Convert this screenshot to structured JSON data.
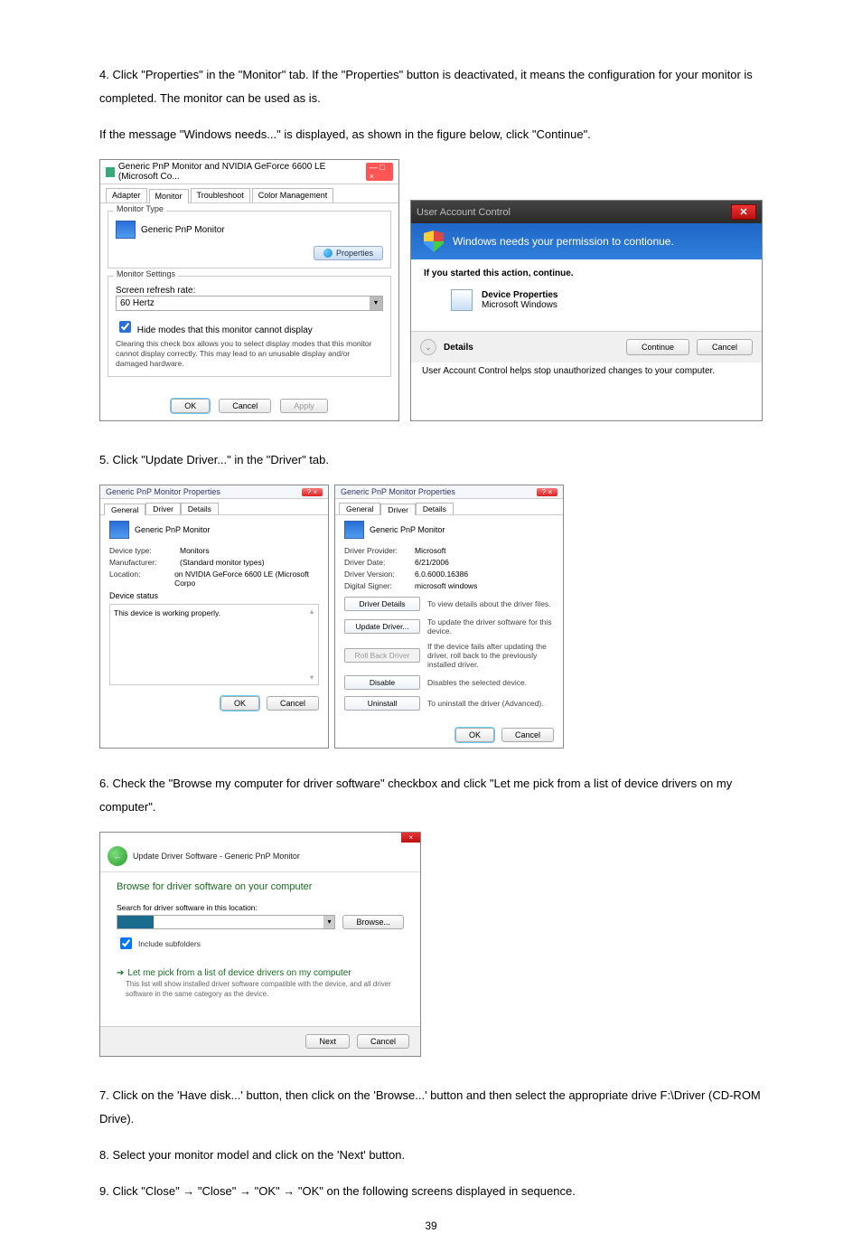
{
  "text": {
    "step4": "4. Click \"Properties\" in the \"Monitor\" tab. If the \"Properties\" button is deactivated, it means the configuration for your monitor is completed. The monitor can be used as is.",
    "step4b": "If the message \"Windows needs...\" is displayed, as shown in the figure below, click \"Continue\".",
    "step5": "5. Click \"Update Driver...\" in the \"Driver\" tab.",
    "step6": "6. Check the \"Browse my computer for driver software\" checkbox and click \"Let me pick from a list of device drivers on my computer\".",
    "step7": "7. Click on the 'Have disk...' button, then click on the 'Browse...' button and then select the appropriate drive F:\\Driver (CD-ROM Drive).",
    "step8": "8. Select your monitor model and click on the 'Next' button.",
    "step9": "9. Click \"Close\"  →  \"Close\"  →  \"OK\"  →  \"OK\" on the following screens displayed in sequence."
  },
  "fig1": {
    "dlg": {
      "title": "Generic PnP Monitor and NVIDIA GeForce 6600 LE (Microsoft Co...",
      "tabs": [
        "Adapter",
        "Monitor",
        "Troubleshoot",
        "Color Management"
      ],
      "group_type": "Monitor Type",
      "monitor_name": "Generic PnP Monitor",
      "properties_btn": "Properties",
      "group_settings": "Monitor Settings",
      "refresh_label": "Screen refresh rate:",
      "refresh_value": "60 Hertz",
      "hide_cb": "Hide modes that this monitor cannot display",
      "hide_desc": "Clearing this check box allows you to select display modes that this monitor cannot display correctly. This may lead to an unusable display and/or damaged hardware.",
      "ok": "OK",
      "cancel": "Cancel",
      "apply": "Apply"
    },
    "uac": {
      "title": "User Account Control",
      "head": "Windows needs your permission to contionue.",
      "ifyou": "If you started this action, continue.",
      "prog1": "Device Properties",
      "prog2": "Microsoft Windows",
      "details": "Details",
      "continue": "Continue",
      "cancel": "Cancel",
      "msg": "User Account Control helps stop unauthorized changes to your computer."
    }
  },
  "fig2": {
    "left": {
      "title": "Generic PnP Monitor Properties",
      "tabs": [
        "General",
        "Driver",
        "Details"
      ],
      "name": "Generic PnP Monitor",
      "k_type": "Device type:",
      "v_type": "Monitors",
      "k_man": "Manufacturer:",
      "v_man": "(Standard monitor types)",
      "k_loc": "Location:",
      "v_loc": "on NVIDIA GeForce 6600 LE (Microsoft Corpo",
      "status_label": "Device status",
      "status_text": "This device is working properly.",
      "ok": "OK",
      "cancel": "Cancel"
    },
    "right": {
      "title": "Generic PnP Monitor Properties",
      "tabs": [
        "General",
        "Driver",
        "Details"
      ],
      "name": "Generic PnP Monitor",
      "k_prov": "Driver Provider:",
      "v_prov": "Microsoft",
      "k_date": "Driver Date:",
      "v_date": "6/21/2006",
      "k_ver": "Driver Version:",
      "v_ver": "6.0.6000.16386",
      "k_sig": "Digital Signer:",
      "v_sig": "microsoft windows",
      "btn_details": "Driver Details",
      "desc_details": "To view details about the driver files.",
      "btn_update": "Update Driver...",
      "desc_update": "To update the driver software for this device.",
      "btn_roll": "Roll Back Driver",
      "desc_roll": "If the device fails after updating the driver, roll back to the previously installed driver.",
      "btn_disable": "Disable",
      "desc_disable": "Disables the selected device.",
      "btn_uninstall": "Uninstall",
      "desc_uninstall": "To uninstall the driver (Advanced).",
      "ok": "OK",
      "cancel": "Cancel"
    }
  },
  "fig3": {
    "crumb": "Update Driver Software - Generic PnP Monitor",
    "heading": "Browse for driver software on your computer",
    "search_label": "Search for driver software in this location:",
    "browse": "Browse...",
    "include": "Include subfolders",
    "pick_head": "Let me pick from a list of device drivers on my computer",
    "pick_desc": "This list will show installed driver software compatible with the device, and all driver software in the same category as the device.",
    "next": "Next",
    "cancel": "Cancel"
  },
  "page_number": "39"
}
